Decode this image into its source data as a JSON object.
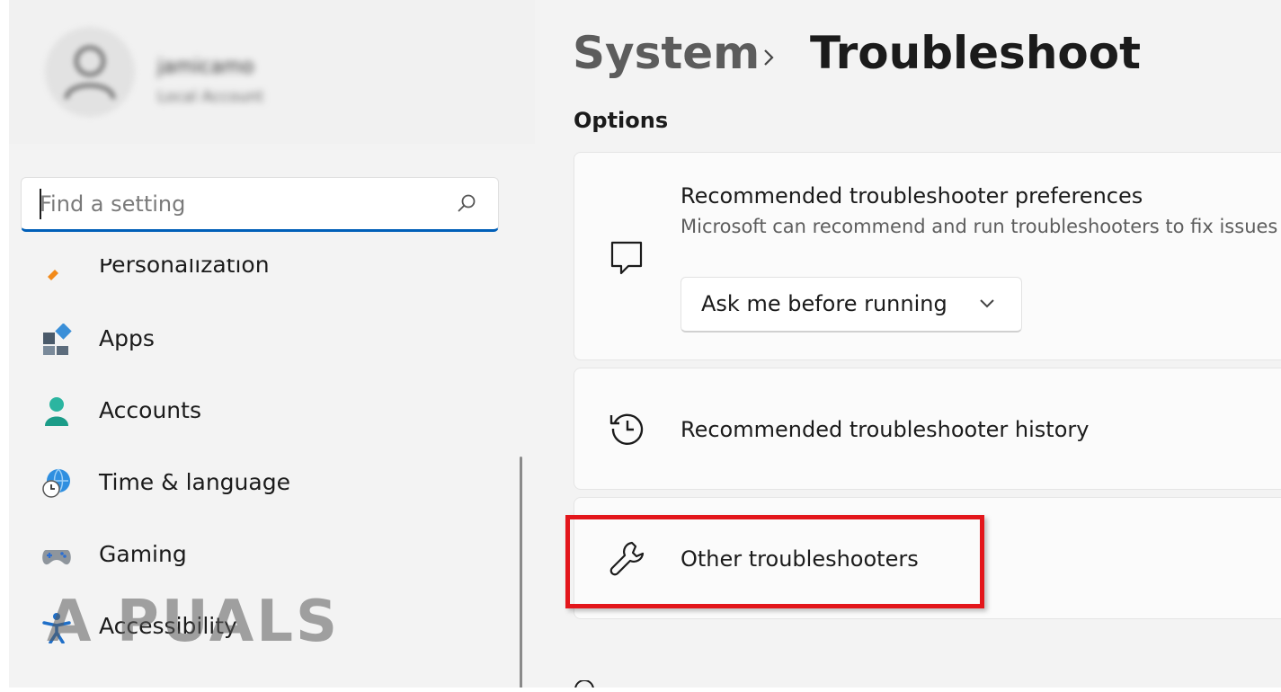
{
  "sidebar": {
    "account": {
      "name": "jamicamo",
      "type": "Local Account"
    },
    "search": {
      "placeholder": "Find a setting"
    },
    "items": [
      {
        "label": "Personalization",
        "icon": "brush-icon"
      },
      {
        "label": "Apps",
        "icon": "apps-icon"
      },
      {
        "label": "Accounts",
        "icon": "person-icon"
      },
      {
        "label": "Time & language",
        "icon": "globe-clock-icon"
      },
      {
        "label": "Gaming",
        "icon": "gamepad-icon"
      },
      {
        "label": "Accessibility",
        "icon": "accessibility-icon"
      }
    ]
  },
  "watermark": {
    "text": "A PUALS"
  },
  "header": {
    "parent": "System",
    "current": "Troubleshoot"
  },
  "main": {
    "section_title": "Options",
    "cards": [
      {
        "title": "Recommended troubleshooter preferences",
        "description": "Microsoft can recommend and run troubleshooters to fix issues",
        "icon": "chat-bubble-icon",
        "dropdown_value": "Ask me before running"
      },
      {
        "title": "Recommended troubleshooter history",
        "icon": "history-icon"
      },
      {
        "title": "Other troubleshooters",
        "icon": "wrench-icon",
        "highlighted": true
      }
    ]
  },
  "colors": {
    "accent": "#005fb8",
    "highlight": "#e3161b",
    "background": "#f3f3f3",
    "card": "#fbfbfb"
  }
}
